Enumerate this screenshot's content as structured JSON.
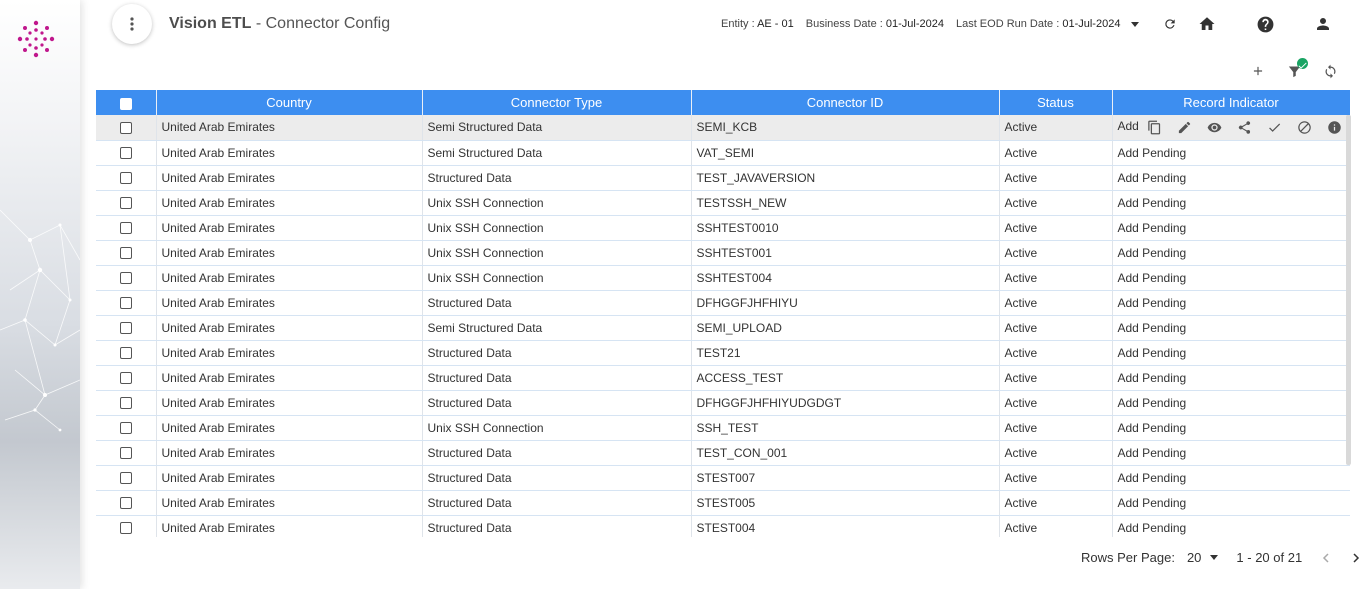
{
  "app": {
    "title_bold": "Vision ETL",
    "title_rest": " - Connector Config"
  },
  "info": {
    "entity_label": "Entity : ",
    "entity_value": "AE - 01",
    "business_date_label": "Business Date : ",
    "business_date_value": "01-Jul-2024",
    "eod_label": "Last EOD Run Date : ",
    "eod_value": "01-Jul-2024"
  },
  "icons": {
    "menu": "more-vert-icon",
    "refresh": "refresh-icon",
    "home": "home-icon",
    "help": "help-icon",
    "user": "account-icon",
    "add": "add-icon",
    "filter": "filter-icon",
    "sync": "sync-icon"
  },
  "colors": {
    "header_bg": "#3d8ef0",
    "accent": "#c0178c",
    "badge": "#19a463"
  },
  "table": {
    "columns": [
      "Country",
      "Connector Type",
      "Connector ID",
      "Status",
      "Record Indicator"
    ],
    "rows": [
      [
        "United Arab Emirates",
        "Semi Structured Data",
        "SEMI_KCB",
        "Active",
        "Add"
      ],
      [
        "United Arab Emirates",
        "Semi Structured Data",
        "VAT_SEMI",
        "Active",
        "Add Pending"
      ],
      [
        "United Arab Emirates",
        "Structured Data",
        "TEST_JAVAVERSION",
        "Active",
        "Add Pending"
      ],
      [
        "United Arab Emirates",
        "Unix SSH Connection",
        "TESTSSH_NEW",
        "Active",
        "Add Pending"
      ],
      [
        "United Arab Emirates",
        "Unix SSH Connection",
        "SSHTEST0010",
        "Active",
        "Add Pending"
      ],
      [
        "United Arab Emirates",
        "Unix SSH Connection",
        "SSHTEST001",
        "Active",
        "Add Pending"
      ],
      [
        "United Arab Emirates",
        "Unix SSH Connection",
        "SSHTEST004",
        "Active",
        "Add Pending"
      ],
      [
        "United Arab Emirates",
        "Structured Data",
        "DFHGGFJHFHIYU",
        "Active",
        "Add Pending"
      ],
      [
        "United Arab Emirates",
        "Semi Structured Data",
        "SEMI_UPLOAD",
        "Active",
        "Add Pending"
      ],
      [
        "United Arab Emirates",
        "Structured Data",
        "TEST21",
        "Active",
        "Add Pending"
      ],
      [
        "United Arab Emirates",
        "Structured Data",
        "ACCESS_TEST",
        "Active",
        "Add Pending"
      ],
      [
        "United Arab Emirates",
        "Structured Data",
        "DFHGGFJHFHIYUDGDGT",
        "Active",
        "Add Pending"
      ],
      [
        "United Arab Emirates",
        "Unix SSH Connection",
        "SSH_TEST",
        "Active",
        "Add Pending"
      ],
      [
        "United Arab Emirates",
        "Structured Data",
        "TEST_CON_001",
        "Active",
        "Add Pending"
      ],
      [
        "United Arab Emirates",
        "Structured Data",
        "STEST007",
        "Active",
        "Add Pending"
      ],
      [
        "United Arab Emirates",
        "Structured Data",
        "STEST005",
        "Active",
        "Add Pending"
      ],
      [
        "United Arab Emirates",
        "Structured Data",
        "STEST004",
        "Active",
        "Add Pending"
      ]
    ],
    "row_actions": [
      "copy-icon",
      "edit-icon",
      "view-icon",
      "share-icon",
      "approve-icon",
      "reject-icon",
      "info-icon"
    ]
  },
  "pager": {
    "rows_per_page_label": "Rows Per Page:",
    "rows_per_page": "20",
    "range": "1 - 20 of 21"
  }
}
